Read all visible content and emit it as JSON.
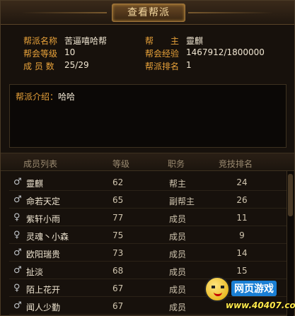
{
  "window": {
    "title": "查看帮派"
  },
  "info": {
    "rows": [
      {
        "label_left": "帮派名称",
        "value_left": "苦逼嘻哈帮",
        "label_right": "帮　　主",
        "value_right": "靈麒"
      },
      {
        "label_left": "帮会等级",
        "value_left": "10",
        "label_right": "帮会经验",
        "value_right": "1467912/1800000"
      },
      {
        "label_left": "成 员 数",
        "value_left": "25/29",
        "label_right": "帮派排名",
        "value_right": "1"
      }
    ]
  },
  "intro": {
    "label": "帮派介绍：",
    "text": "哈哈"
  },
  "members": {
    "columns": [
      "成员列表",
      "等级",
      "职务",
      "竞技排名"
    ],
    "rows": [
      {
        "gender": "male",
        "icon": "male-icon",
        "name": "靈麒",
        "level": "62",
        "role": "帮主",
        "rank": "24"
      },
      {
        "gender": "male",
        "icon": "male-icon",
        "name": "命若天定",
        "level": "65",
        "role": "副帮主",
        "rank": "26"
      },
      {
        "gender": "female",
        "icon": "female-icon",
        "name": "紫轩小雨",
        "level": "77",
        "role": "成员",
        "rank": "11"
      },
      {
        "gender": "female",
        "icon": "female-icon",
        "name": "灵魂丶小森",
        "level": "75",
        "role": "成员",
        "rank": "9"
      },
      {
        "gender": "male",
        "icon": "male-icon",
        "name": "欧阳瑞贵",
        "level": "73",
        "role": "成员",
        "rank": "14"
      },
      {
        "gender": "male",
        "icon": "male-icon",
        "name": "扯淡",
        "level": "68",
        "role": "成员",
        "rank": "15"
      },
      {
        "gender": "female",
        "icon": "female-icon",
        "name": "陌上花开",
        "level": "67",
        "role": "成员",
        "rank": "17"
      },
      {
        "gender": "male",
        "icon": "male-icon",
        "name": "闻人少勤",
        "level": "67",
        "role": "成员",
        "rank": ""
      }
    ]
  },
  "watermark": {
    "title": "网页游戏",
    "url": "www.40407.com"
  }
}
